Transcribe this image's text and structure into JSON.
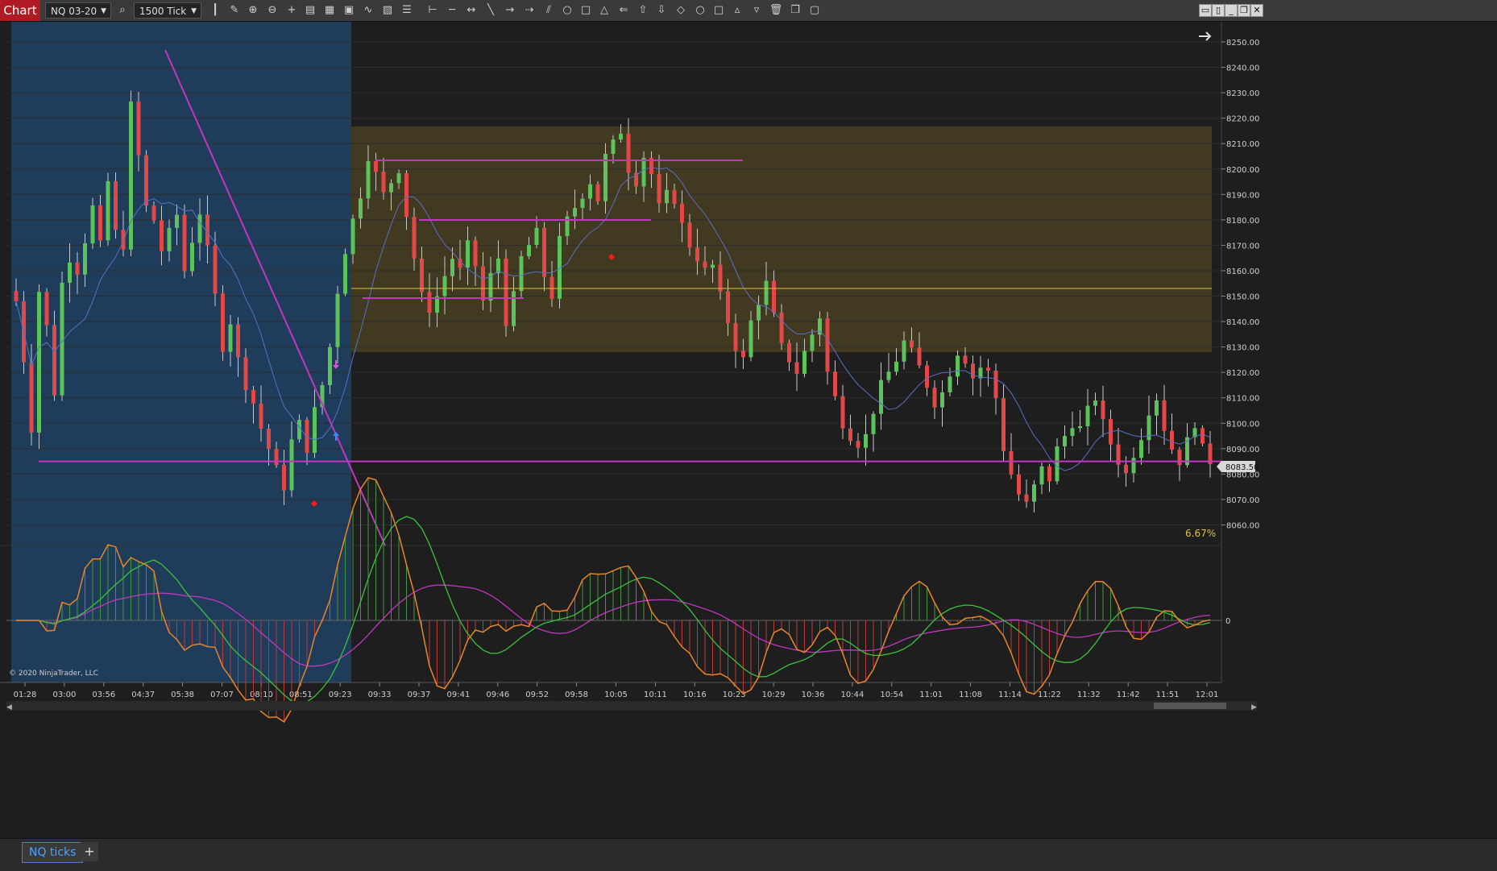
{
  "toolbar": {
    "chart_tab": "Chart",
    "instrument": "NQ 03-20",
    "bar_type": "1500 Tick"
  },
  "chart_data": {
    "type": "candlestick",
    "instrument": "NQ 03-20",
    "interval": "1500 Tick",
    "y_ticks": [
      8250,
      8240,
      8230,
      8220,
      8210,
      8200,
      8190,
      8180,
      8170,
      8160,
      8150,
      8140,
      8130,
      8120,
      8110,
      8100,
      8090,
      8080,
      8070,
      8060
    ],
    "y_tick_labels": [
      "8250.00",
      "8240.00",
      "8230.00",
      "8220.00",
      "8210.00",
      "8200.00",
      "8190.00",
      "8180.00",
      "8170.00",
      "8160.00",
      "8150.00",
      "8140.00",
      "8130.00",
      "8120.00",
      "8110.00",
      "8100.00",
      "8090.00",
      "8080.00",
      "8070.00",
      "8060.00"
    ],
    "ylim": [
      8050,
      8255
    ],
    "x_labels": [
      "01:28",
      "03:00",
      "03:56",
      "04:37",
      "05:38",
      "07:07",
      "08:10",
      "08:51",
      "09:23",
      "09:33",
      "09:37",
      "09:41",
      "09:46",
      "09:52",
      "09:58",
      "10:05",
      "10:11",
      "10:16",
      "10:23",
      "10:29",
      "10:36",
      "10:44",
      "10:54",
      "11:01",
      "11:08",
      "11:14",
      "11:22",
      "11:32",
      "11:42",
      "11:51",
      "12:01"
    ],
    "last_price": "8083.50",
    "percent_label": "6.67%",
    "copyright": "© 2020 NinjaTrader, LLC",
    "oscillator_zero_label": "0",
    "price_path": [
      8148,
      8125,
      8098,
      8152,
      8138,
      8112,
      8155,
      8165,
      8160,
      8172,
      8185,
      8170,
      8195,
      8175,
      8170,
      8225,
      8205,
      8185,
      8180,
      8168,
      8175,
      8182,
      8160,
      8172,
      8183,
      8168,
      8150,
      8130,
      8140,
      8125,
      8115,
      8108,
      8098,
      8090,
      8082,
      8075,
      8093,
      8100,
      8090,
      8105,
      8115,
      8130,
      8152,
      8168,
      8180,
      8190,
      8205,
      8198,
      8190,
      8195,
      8200,
      8182,
      8165,
      8150,
      8145,
      8150,
      8158,
      8165,
      8160,
      8170,
      8162,
      8148,
      8158,
      8165,
      8140,
      8150,
      8165,
      8170,
      8175,
      8158,
      8150,
      8172,
      8180,
      8185,
      8190,
      8195,
      8188,
      8205,
      8210,
      8215,
      8200,
      8195,
      8205,
      8198,
      8185,
      8190,
      8188,
      8178,
      8170,
      8165,
      8160,
      8162,
      8150,
      8140,
      8130,
      8125,
      8140,
      8148,
      8155,
      8142,
      8130,
      8125,
      8120,
      8128,
      8135,
      8142,
      8120,
      8110,
      8100,
      8095,
      8092,
      8095,
      8105,
      8115,
      8120,
      8125,
      8132,
      8128,
      8122,
      8115,
      8108,
      8112,
      8120,
      8128,
      8125,
      8118,
      8122,
      8120,
      8110,
      8090,
      8080,
      8072,
      8068,
      8075,
      8082,
      8078,
      8090,
      8095,
      8100,
      8098,
      8105,
      8110,
      8100,
      8092,
      8085,
      8080,
      8088,
      8095,
      8105,
      8110,
      8098,
      8090,
      8085,
      8093,
      8100,
      8090,
      8085
    ],
    "horizontal_levels": [
      8153,
      8085
    ],
    "zone": {
      "top": 8217,
      "bottom": 8128
    }
  },
  "bottom": {
    "tab_label": "NQ ticks",
    "add_tab": "+"
  },
  "colors": {
    "up": "#5cc25c",
    "down": "#e24848",
    "sma": "#5571c4",
    "line": "#c037c0",
    "zone": "#4a4020",
    "session": "#1f3c5a",
    "level": "#d9c23a",
    "osc_fast": "#e8852a",
    "osc_slow": "#3cc23c",
    "osc_signal": "#c037c0"
  }
}
